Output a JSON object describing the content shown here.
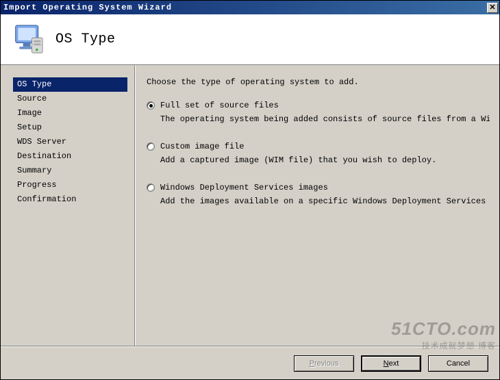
{
  "window": {
    "title": "Import Operating System Wizard"
  },
  "header": {
    "heading": "OS Type"
  },
  "sidebar": {
    "items": [
      {
        "label": "OS Type",
        "active": true
      },
      {
        "label": "Source",
        "active": false
      },
      {
        "label": "Image",
        "active": false
      },
      {
        "label": "Setup",
        "active": false
      },
      {
        "label": "WDS Server",
        "active": false
      },
      {
        "label": "Destination",
        "active": false
      },
      {
        "label": "Summary",
        "active": false
      },
      {
        "label": "Progress",
        "active": false
      },
      {
        "label": "Confirmation",
        "active": false
      }
    ]
  },
  "content": {
    "instruction": "Choose the type of operating system to add.",
    "options": [
      {
        "label": "Full set of source files",
        "description": "The operating system being added consists of source files from a Windows DVD,",
        "checked": true
      },
      {
        "label": "Custom image file",
        "description": "Add a captured image (WIM file) that you wish to deploy.",
        "checked": false
      },
      {
        "label": "Windows Deployment Services images",
        "description": "Add the images available on a specific Windows Deployment Services server.",
        "checked": false
      }
    ]
  },
  "buttons": {
    "previous": "Previous",
    "next": "Next",
    "cancel": "Cancel"
  },
  "watermark": {
    "line1": "51CTO.com",
    "line2": "技术成就梦想 博客"
  }
}
